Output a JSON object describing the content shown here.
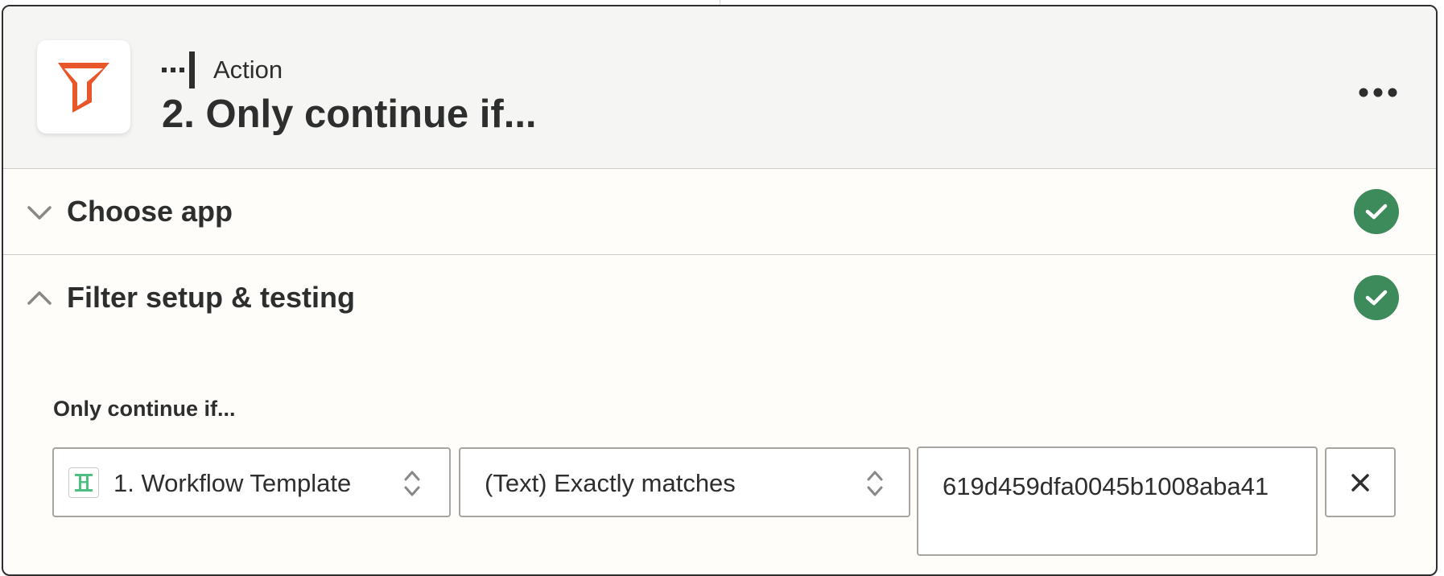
{
  "step": {
    "type_label": "Action",
    "title": "2. Only continue if...",
    "app_icon": "filter-funnel-icon",
    "accent_color": "#e8572a",
    "more_icon": "more-horizontal-icon"
  },
  "sections": {
    "choose_app": {
      "title": "Choose app",
      "state": "collapsed",
      "status": "complete",
      "status_color": "#3d8a5b"
    },
    "filter": {
      "title": "Filter setup & testing",
      "state": "expanded",
      "status": "complete",
      "status_color": "#3d8a5b"
    }
  },
  "filter_rule": {
    "label": "Only continue if...",
    "source_field": {
      "value": "1. Workflow Template",
      "icon": "workflow-template-icon"
    },
    "operator": {
      "value": "(Text) Exactly matches"
    },
    "compare_value": {
      "value": "619d459dfa0045b1008aba41"
    },
    "remove_icon": "close-icon"
  }
}
